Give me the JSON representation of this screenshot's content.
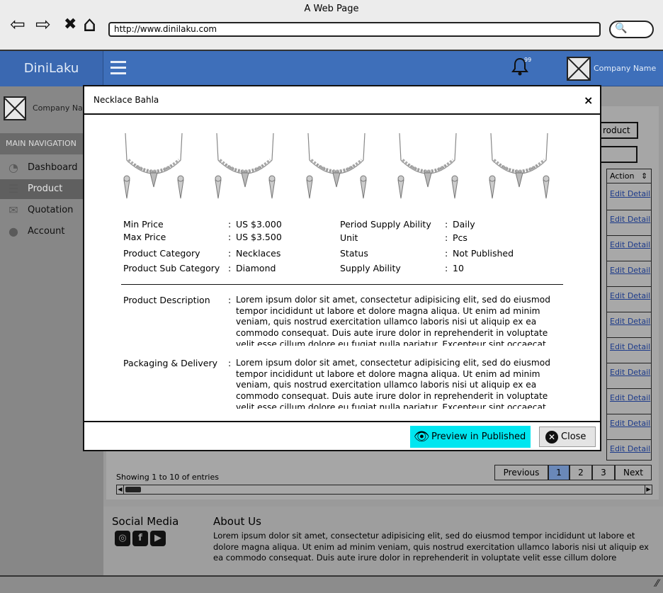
{
  "browser": {
    "title": "A Web Page",
    "url": "http://www.dinilaku.com",
    "back_glyph": "⇦",
    "forward_glyph": "⇨",
    "stop_glyph": "✖",
    "home_glyph": "⌂",
    "search_glyph": "🔍"
  },
  "header": {
    "brand": "DiniLaku",
    "notification_count": "99",
    "company_name": "Company Name"
  },
  "sidebar": {
    "company_name": "Company Name",
    "section_title": "MAIN NAVIGATION",
    "items": [
      {
        "label": "Dashboard",
        "icon": "dashboard-icon",
        "glyph": "◔"
      },
      {
        "label": "Product",
        "icon": "list-icon",
        "glyph": "☰",
        "active": true
      },
      {
        "label": "Quotation",
        "icon": "envelope-icon",
        "glyph": "✉"
      },
      {
        "label": "Account",
        "icon": "user-icon",
        "glyph": "●"
      }
    ]
  },
  "background_table": {
    "add_button": "roduct",
    "action_header": "Action",
    "row_links": [
      "Edit",
      "Detail"
    ],
    "row_count": 11,
    "showing": "Showing 1 to 10 of entries",
    "pagination": [
      "Previous",
      "1",
      "2",
      "3",
      "Next"
    ],
    "current_page": "1"
  },
  "footer": {
    "social_title": "Social Media",
    "social_icons": [
      "instagram-icon",
      "facebook-icon",
      "youtube-icon"
    ],
    "about_title": "About Us",
    "about_text": "Lorem ipsum dolor sit amet, consectetur adipisicing elit, sed do eiusmod tempor incididunt ut labore et dolore magna aliqua. Ut enim ad minim veniam, quis nostrud exercitation ullamco laboris nisi ut aliquip ex ea commodo consequat. Duis aute irure dolor in reprehenderit in voluptate velit esse cillum dolore"
  },
  "modal": {
    "title": "Necklace Bahla",
    "close_x": "×",
    "image_count": 5,
    "details_left": [
      {
        "label": "Min Price",
        "value": "US $3.000"
      },
      {
        "label": "Max Price",
        "value": "US $3.500"
      },
      {
        "label": "Product Category",
        "value": "Necklaces"
      },
      {
        "label": "Product Sub Category",
        "value": "Diamond"
      }
    ],
    "details_right": [
      {
        "label": "Period Supply Ability",
        "value": "Daily"
      },
      {
        "label": "Unit",
        "value": "Pcs"
      },
      {
        "label": "Status",
        "value": "Not Published"
      },
      {
        "label": "Supply Ability",
        "value": "10"
      }
    ],
    "separator": ":",
    "description_label": "Product Description",
    "description": "Lorem ipsum dolor sit amet, consectetur adipisicing elit, sed do eiusmod tempor incididunt ut labore et dolore magna aliqua. Ut enim ad minim veniam, quis nostrud exercitation ullamco laboris nisi ut aliquip ex ea commodo consequat. Duis aute irure dolor in reprehenderit in voluptate velit esse cillum dolore eu fugiat nulla pariatur. Excepteur sint occaecat cupidatat non proident.",
    "packaging_label": "Packaging & Delivery",
    "packaging": "Lorem ipsum dolor sit amet, consectetur adipisicing elit, sed do eiusmod tempor incididunt ut labore et dolore magna aliqua. Ut enim ad minim veniam, quis nostrud exercitation ullamco laboris nisi ut aliquip ex ea commodo consequat. Duis aute irure dolor in reprehenderit in voluptate velit esse cillum dolore eu fugiat nulla pariatur. Excepteur sint occaecat cupidatat non proident.",
    "preview_button": "Preview in Published",
    "close_button": "Close"
  }
}
